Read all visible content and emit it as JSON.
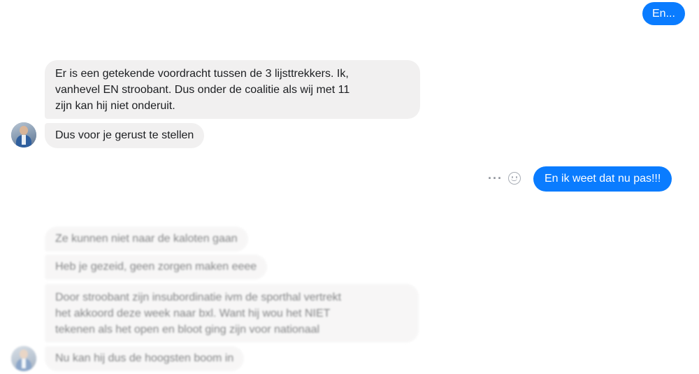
{
  "conversation": {
    "outgoing": [
      {
        "id": "out1",
        "text": "En..."
      },
      {
        "id": "out2",
        "text": "En ik weet dat nu pas!!!"
      }
    ],
    "incoming_group1": {
      "message1": {
        "lines": [
          "Er is een getekende voordracht tussen de 3 lijsttrekkers. Ik,",
          "vanhevel EN stroobant. Dus onder de coalitie als wij met 11",
          "zijn kan hij niet onderuit."
        ]
      },
      "message2": {
        "text": "Dus voor je gerust te stellen"
      }
    },
    "incoming_group2": {
      "message1": {
        "text": "Ze kunnen niet naar de kaloten gaan"
      },
      "message2": {
        "text": "Heb je gezeid, geen zorgen maken eeee"
      },
      "message3": {
        "lines": [
          "Door stroobant zijn insubordinatie ivm de sporthal vertrekt",
          "het akkoord deze week naar bxl. Want hij wou het NIET",
          "tekenen als het open en bloot ging zijn voor nationaal"
        ]
      },
      "message4": {
        "text": "Nu kan hij dus de hoogsten boom in"
      }
    },
    "icons": {
      "more": "more-options-icon",
      "emoji": "emoji-react-icon"
    },
    "colors": {
      "outgoing_bubble": "#0a7cff",
      "incoming_bubble": "#f1f0f0"
    }
  }
}
